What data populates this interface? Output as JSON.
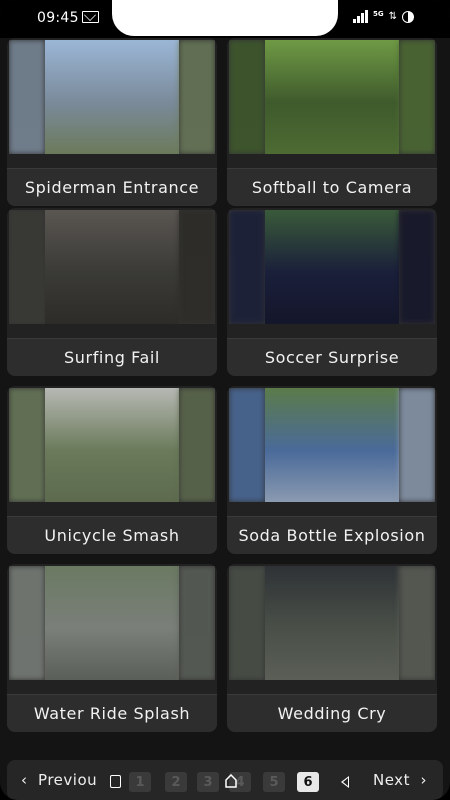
{
  "status": {
    "time": "09:45",
    "network": "5G",
    "icons": [
      "mail-icon",
      "signal-icon",
      "data-icon",
      "circle-icon"
    ]
  },
  "videos": [
    {
      "title": "Spiderman Entrance",
      "colors": [
        "#7a8a9a",
        "#9bb6d6",
        "#6b7a5a"
      ]
    },
    {
      "title": "Softball to Camera",
      "colors": [
        "#3f5a2c",
        "#6f9a45",
        "#4d6b33"
      ]
    },
    {
      "title": "Surfing Fail",
      "colors": [
        "#3a3a36",
        "#5a5652",
        "#2e2c28"
      ]
    },
    {
      "title": "Soccer Surprise",
      "colors": [
        "#1a1f3a",
        "#3a5a3a",
        "#14162a"
      ]
    },
    {
      "title": "Unicycle Smash",
      "colors": [
        "#6a7a5a",
        "#b7b9b4",
        "#5d6a4e"
      ]
    },
    {
      "title": "Soda Bottle Explosion",
      "colors": [
        "#4a6a9a",
        "#5b7b4a",
        "#8a9ab0"
      ]
    },
    {
      "title": "Water Ride Splash",
      "colors": [
        "#7a7f7a",
        "#6b7a62",
        "#5a5f58"
      ]
    },
    {
      "title": "Wedding Cry",
      "colors": [
        "#4a5048",
        "#2e3236",
        "#5a5e56"
      ]
    }
  ],
  "pagination": {
    "previous_label": "Previou",
    "next_label": "Next",
    "pages": [
      "1",
      "2",
      "3",
      "4",
      "5",
      "6"
    ],
    "current_page": "6"
  }
}
